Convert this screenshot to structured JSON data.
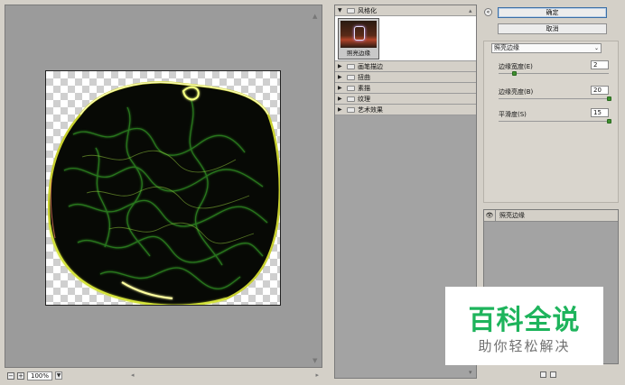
{
  "preview": {
    "zoom": "100%",
    "zoom_out_icon": "minus-square-icon",
    "zoom_in_icon": "plus-square-icon"
  },
  "gallery": {
    "stylize": {
      "label": "风格化",
      "thumbnail_label": "照亮边缘"
    },
    "categories": [
      {
        "label": "画笔描边"
      },
      {
        "label": "扭曲"
      },
      {
        "label": "素描"
      },
      {
        "label": "纹理"
      },
      {
        "label": "艺术效果"
      }
    ]
  },
  "settings": {
    "ok_label": "确定",
    "cancel_label": "取消",
    "filter_select": "照亮边缘",
    "params": [
      {
        "label": "边缘宽度(E)",
        "value": "2",
        "level": 0.14
      },
      {
        "label": "边缘亮度(B)",
        "value": "20",
        "level": 1.0
      },
      {
        "label": "平滑度(S)",
        "value": "15",
        "level": 1.0
      }
    ],
    "layer_label": "照亮边缘"
  },
  "watermark": {
    "title": "百科全说",
    "subtitle": "助你轻松解决"
  }
}
